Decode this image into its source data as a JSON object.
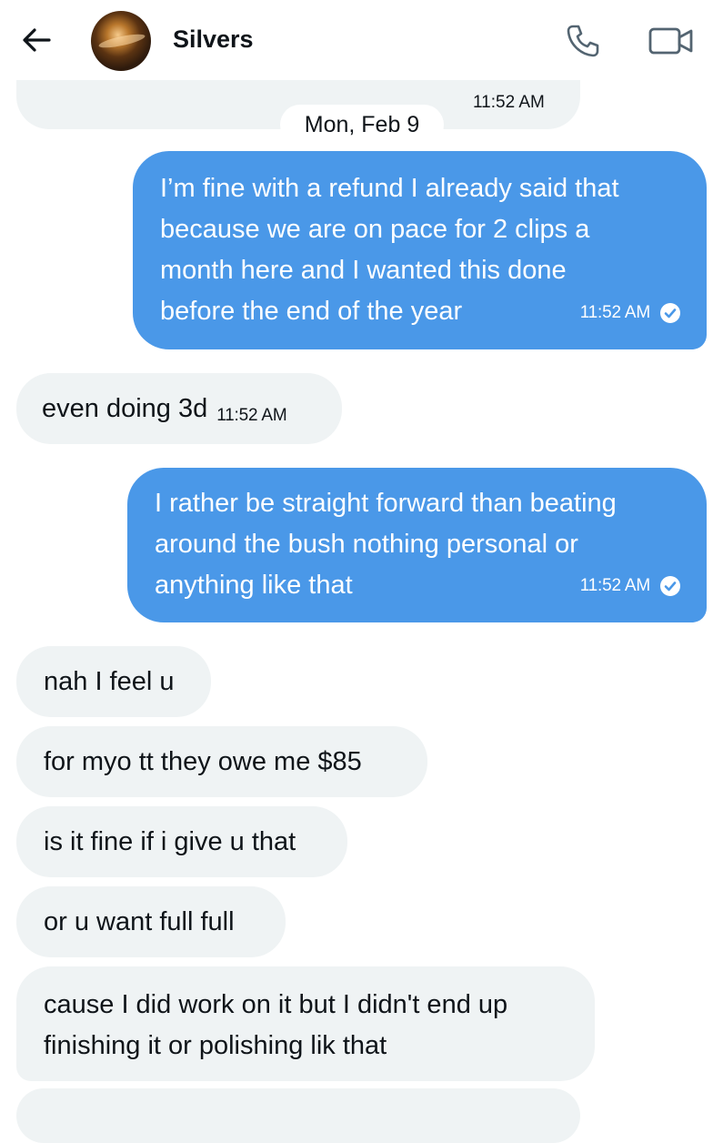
{
  "header": {
    "contact_name": "Silvers",
    "back_icon": "back-arrow-icon",
    "phone_icon": "phone-icon",
    "video_icon": "video-call-icon"
  },
  "previous_message": {
    "time": "11:52 AM"
  },
  "date_separator": "Mon, Feb 9",
  "messages": [
    {
      "direction": "outgoing",
      "lines": [
        "I’m fine with a refund I already said that",
        "because we are on pace for 2 clips a",
        "month here and I wanted this done",
        "before the end of the year"
      ],
      "time": "11:52 AM",
      "status_icon": "read-check-icon"
    },
    {
      "direction": "incoming",
      "text": "even doing 3d",
      "time": "11:52 AM"
    },
    {
      "direction": "outgoing",
      "lines": [
        "I rather be straight forward than beating",
        "around the bush nothing personal or",
        "anything like that"
      ],
      "time": "11:52 AM",
      "status_icon": "read-check-icon"
    },
    {
      "direction": "incoming",
      "text": "nah I feel u"
    },
    {
      "direction": "incoming",
      "text": "for myo tt they owe me $85"
    },
    {
      "direction": "incoming",
      "text": "is it fine if i give u that"
    },
    {
      "direction": "incoming",
      "text": "or u want full full"
    },
    {
      "direction": "incoming",
      "lines": [
        "cause I did work on it but I didn't end up",
        "finishing it or polishing lik that"
      ]
    }
  ],
  "colors": {
    "outgoing_bubble": "#4a98e8",
    "incoming_bubble": "#eff3f4",
    "text": "#0f1419",
    "background": "#ffffff"
  }
}
